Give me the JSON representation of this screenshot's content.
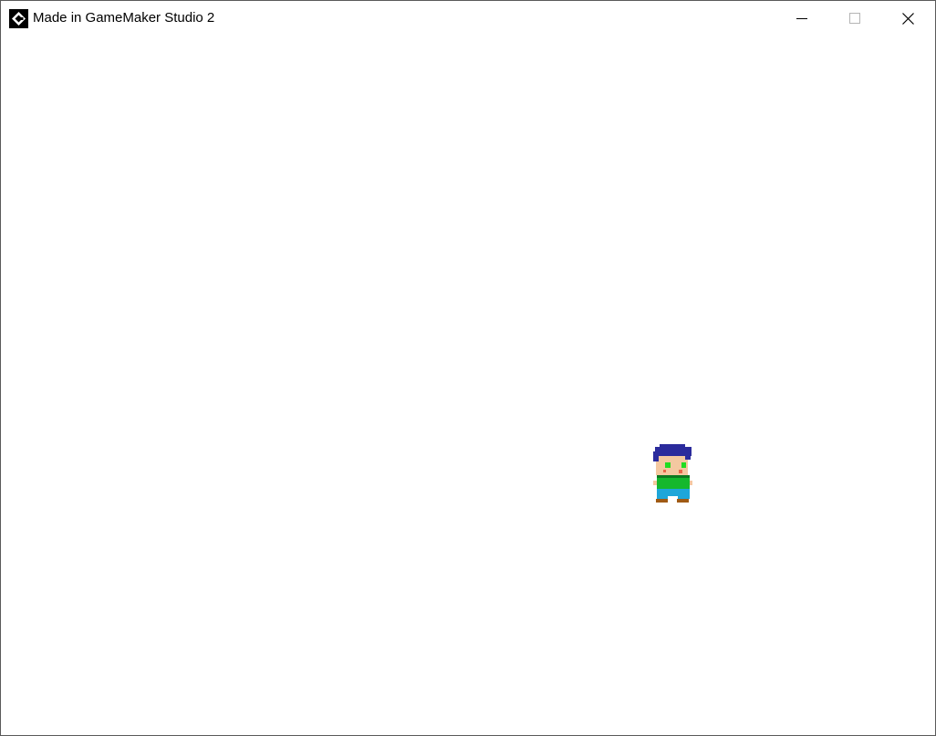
{
  "window": {
    "title": "Made in GameMaker Studio 2",
    "app_icon": "gamemaker-icon",
    "controls": {
      "minimize_icon": "minimize-icon",
      "maximize_icon": "maximize-icon",
      "close_icon": "close-icon"
    }
  },
  "game": {
    "background_color": "#ffffff",
    "player_sprite": "player-character",
    "colors": {
      "hair": "#2b2b9c",
      "skin": "#f4c8a0",
      "eyes": "#22dd22",
      "cheeks": "#e8684a",
      "shirt": "#15b82d",
      "belt": "#0d7a20",
      "pants": "#1ea6d9",
      "shoes": "#a05a14"
    }
  }
}
